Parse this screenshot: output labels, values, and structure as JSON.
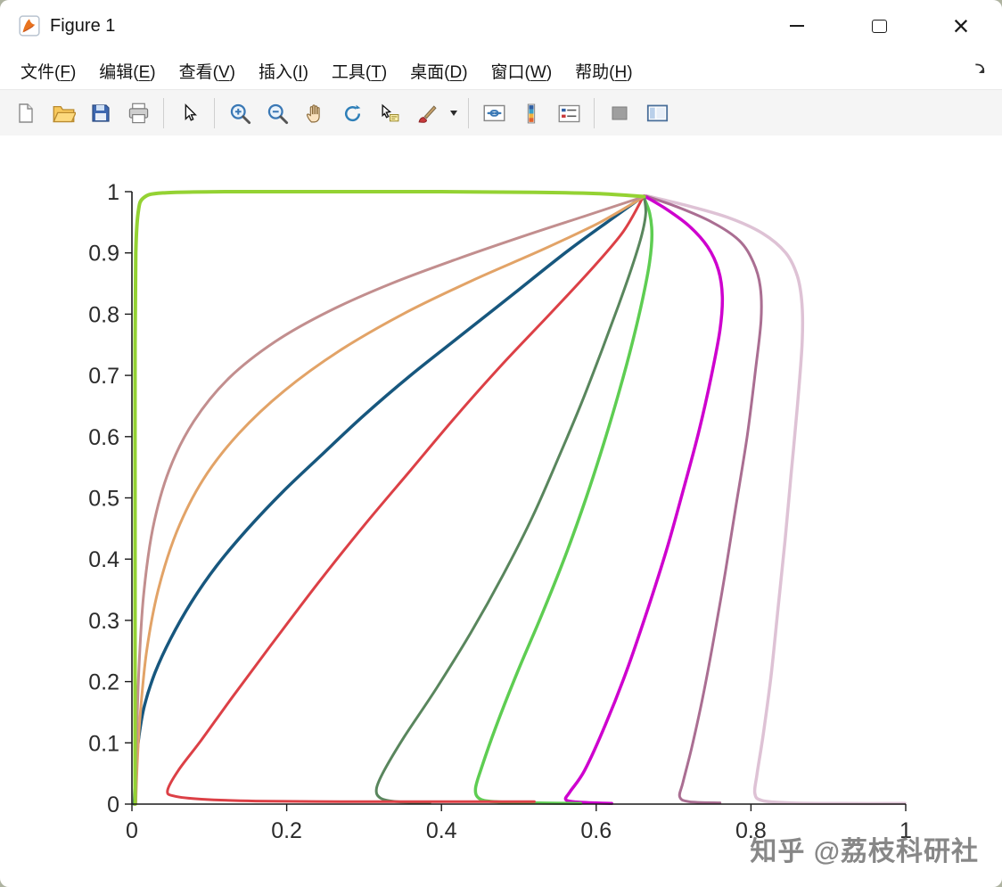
{
  "window": {
    "title": "Figure 1",
    "controls": {
      "minimize_glyph": "–",
      "maximize_glyph": "□",
      "close_glyph": "×"
    }
  },
  "menu": {
    "items": [
      {
        "pre": "文件(",
        "key": "F",
        "post": ")"
      },
      {
        "pre": "编辑(",
        "key": "E",
        "post": ")"
      },
      {
        "pre": "查看(",
        "key": "V",
        "post": ")"
      },
      {
        "pre": "插入(",
        "key": "I",
        "post": ")"
      },
      {
        "pre": "工具(",
        "key": "T",
        "post": ")"
      },
      {
        "pre": "桌面(",
        "key": "D",
        "post": ")"
      },
      {
        "pre": "窗口(",
        "key": "W",
        "post": ")"
      },
      {
        "pre": "帮助(",
        "key": "H",
        "post": ")"
      }
    ]
  },
  "toolbar": {
    "buttons": [
      "new-figure",
      "open-file",
      "save-figure",
      "print-figure",
      "pointer-tool",
      "zoom-in",
      "zoom-out",
      "pan-hand",
      "rotate-3d",
      "data-cursor",
      "brush",
      "brush-dropdown",
      "link-plots",
      "insert-colorbar",
      "insert-legend",
      "hide-plot-tools",
      "show-plot-tools"
    ]
  },
  "watermark": "知乎 @荔枝科研社",
  "chart_data": {
    "type": "line",
    "title": "",
    "xlabel": "",
    "ylabel": "",
    "xlim": [
      0,
      1
    ],
    "ylim": [
      0,
      1
    ],
    "grid": false,
    "legend": "none",
    "xticks": [
      "0",
      "0.2",
      "0.4",
      "0.6",
      "0.8",
      "1"
    ],
    "yticks": [
      "0",
      "0.1",
      "0.2",
      "0.3",
      "0.4",
      "0.5",
      "0.6",
      "0.7",
      "0.8",
      "0.9",
      "1"
    ],
    "series": [
      {
        "name": "pale-pink",
        "color": "#DEC2D5",
        "width": 3.5,
        "points": [
          [
            0.666,
            0.993
          ],
          [
            0.715,
            0.978
          ],
          [
            0.77,
            0.958
          ],
          [
            0.815,
            0.932
          ],
          [
            0.845,
            0.9
          ],
          [
            0.86,
            0.862
          ],
          [
            0.866,
            0.815
          ],
          [
            0.866,
            0.75
          ],
          [
            0.86,
            0.65
          ],
          [
            0.852,
            0.54
          ],
          [
            0.844,
            0.43
          ],
          [
            0.835,
            0.32
          ],
          [
            0.826,
            0.21
          ],
          [
            0.816,
            0.115
          ],
          [
            0.808,
            0.05
          ],
          [
            0.805,
            0.018
          ],
          [
            0.814,
            0.006
          ],
          [
            0.85,
            0.002
          ],
          [
            0.92,
            0.001
          ],
          [
            0.999,
            0.001
          ]
        ]
      },
      {
        "name": "mauve",
        "color": "#AA6E92",
        "width": 3,
        "points": [
          [
            0.664,
            0.993
          ],
          [
            0.705,
            0.975
          ],
          [
            0.75,
            0.95
          ],
          [
            0.785,
            0.92
          ],
          [
            0.803,
            0.885
          ],
          [
            0.812,
            0.845
          ],
          [
            0.813,
            0.79
          ],
          [
            0.806,
            0.71
          ],
          [
            0.795,
            0.6
          ],
          [
            0.781,
            0.49
          ],
          [
            0.767,
            0.38
          ],
          [
            0.752,
            0.27
          ],
          [
            0.737,
            0.17
          ],
          [
            0.723,
            0.09
          ],
          [
            0.712,
            0.035
          ],
          [
            0.708,
            0.012
          ],
          [
            0.72,
            0.004
          ],
          [
            0.76,
            0.002
          ]
        ]
      },
      {
        "name": "magenta",
        "color": "#CE00CE",
        "width": 3.5,
        "points": [
          [
            0.662,
            0.993
          ],
          [
            0.69,
            0.972
          ],
          [
            0.72,
            0.944
          ],
          [
            0.744,
            0.91
          ],
          [
            0.758,
            0.872
          ],
          [
            0.763,
            0.828
          ],
          [
            0.76,
            0.775
          ],
          [
            0.749,
            0.7
          ],
          [
            0.733,
            0.61
          ],
          [
            0.714,
            0.52
          ],
          [
            0.692,
            0.42
          ],
          [
            0.667,
            0.32
          ],
          [
            0.64,
            0.22
          ],
          [
            0.612,
            0.13
          ],
          [
            0.585,
            0.055
          ],
          [
            0.566,
            0.02
          ],
          [
            0.561,
            0.007
          ],
          [
            0.578,
            0.003
          ],
          [
            0.62,
            0.001
          ]
        ]
      },
      {
        "name": "lime-green",
        "color": "#5ECD52",
        "width": 3.5,
        "points": [
          [
            0.661,
            0.992
          ],
          [
            0.669,
            0.965
          ],
          [
            0.672,
            0.93
          ],
          [
            0.669,
            0.885
          ],
          [
            0.66,
            0.825
          ],
          [
            0.647,
            0.755
          ],
          [
            0.63,
            0.675
          ],
          [
            0.61,
            0.59
          ],
          [
            0.587,
            0.5
          ],
          [
            0.56,
            0.405
          ],
          [
            0.53,
            0.31
          ],
          [
            0.498,
            0.215
          ],
          [
            0.47,
            0.125
          ],
          [
            0.452,
            0.06
          ],
          [
            0.444,
            0.025
          ],
          [
            0.449,
            0.009
          ],
          [
            0.468,
            0.004
          ],
          [
            0.52,
            0.002
          ],
          [
            0.58,
            0.001
          ]
        ]
      },
      {
        "name": "dark-green",
        "color": "#59865D",
        "width": 3,
        "points": [
          [
            0.662,
            0.992
          ],
          [
            0.664,
            0.965
          ],
          [
            0.659,
            0.93
          ],
          [
            0.647,
            0.88
          ],
          [
            0.629,
            0.815
          ],
          [
            0.607,
            0.74
          ],
          [
            0.581,
            0.655
          ],
          [
            0.551,
            0.565
          ],
          [
            0.518,
            0.47
          ],
          [
            0.48,
            0.375
          ],
          [
            0.438,
            0.28
          ],
          [
            0.394,
            0.19
          ],
          [
            0.352,
            0.11
          ],
          [
            0.326,
            0.055
          ],
          [
            0.316,
            0.025
          ],
          [
            0.321,
            0.01
          ],
          [
            0.342,
            0.004
          ],
          [
            0.385,
            0.002
          ]
        ]
      },
      {
        "name": "red",
        "color": "#DC4046",
        "width": 3,
        "points": [
          [
            0.52,
            0.004
          ],
          [
            0.4,
            0.004
          ],
          [
            0.28,
            0.004
          ],
          [
            0.16,
            0.005
          ],
          [
            0.09,
            0.008
          ],
          [
            0.055,
            0.013
          ],
          [
            0.046,
            0.022
          ],
          [
            0.06,
            0.055
          ],
          [
            0.09,
            0.105
          ],
          [
            0.13,
            0.175
          ],
          [
            0.18,
            0.26
          ],
          [
            0.24,
            0.36
          ],
          [
            0.3,
            0.455
          ],
          [
            0.36,
            0.545
          ],
          [
            0.42,
            0.635
          ],
          [
            0.48,
            0.72
          ],
          [
            0.54,
            0.8
          ],
          [
            0.595,
            0.875
          ],
          [
            0.635,
            0.935
          ],
          [
            0.66,
            0.99
          ]
        ]
      },
      {
        "name": "steel-blue",
        "color": "#17577E",
        "width": 3.5,
        "points": [
          [
            0.003,
            0.0
          ],
          [
            0.005,
            0.06
          ],
          [
            0.009,
            0.11
          ],
          [
            0.016,
            0.16
          ],
          [
            0.03,
            0.215
          ],
          [
            0.05,
            0.27
          ],
          [
            0.077,
            0.33
          ],
          [
            0.11,
            0.39
          ],
          [
            0.15,
            0.45
          ],
          [
            0.195,
            0.51
          ],
          [
            0.245,
            0.57
          ],
          [
            0.3,
            0.635
          ],
          [
            0.36,
            0.7
          ],
          [
            0.425,
            0.765
          ],
          [
            0.495,
            0.835
          ],
          [
            0.565,
            0.905
          ],
          [
            0.625,
            0.96
          ],
          [
            0.658,
            0.99
          ]
        ]
      },
      {
        "name": "sandy-orange",
        "color": "#E2A367",
        "width": 3,
        "points": [
          [
            0.005,
            0.0
          ],
          [
            0.007,
            0.07
          ],
          [
            0.011,
            0.15
          ],
          [
            0.019,
            0.25
          ],
          [
            0.034,
            0.35
          ],
          [
            0.058,
            0.445
          ],
          [
            0.092,
            0.53
          ],
          [
            0.138,
            0.605
          ],
          [
            0.197,
            0.675
          ],
          [
            0.268,
            0.74
          ],
          [
            0.35,
            0.8
          ],
          [
            0.44,
            0.855
          ],
          [
            0.53,
            0.905
          ],
          [
            0.605,
            0.95
          ],
          [
            0.662,
            0.992
          ]
        ]
      },
      {
        "name": "rosy-brown",
        "color": "#C28E8E",
        "width": 3,
        "points": [
          [
            0.005,
            0.0
          ],
          [
            0.006,
            0.1
          ],
          [
            0.009,
            0.22
          ],
          [
            0.015,
            0.34
          ],
          [
            0.027,
            0.45
          ],
          [
            0.048,
            0.545
          ],
          [
            0.08,
            0.625
          ],
          [
            0.125,
            0.695
          ],
          [
            0.185,
            0.755
          ],
          [
            0.255,
            0.805
          ],
          [
            0.335,
            0.85
          ],
          [
            0.42,
            0.89
          ],
          [
            0.505,
            0.927
          ],
          [
            0.585,
            0.96
          ],
          [
            0.662,
            0.992
          ]
        ]
      },
      {
        "name": "yellow-green",
        "color": "#94D233",
        "width": 4,
        "points": [
          [
            0.004,
            0.0
          ],
          [
            0.004,
            0.25
          ],
          [
            0.004,
            0.5
          ],
          [
            0.004,
            0.75
          ],
          [
            0.005,
            0.9
          ],
          [
            0.008,
            0.965
          ],
          [
            0.015,
            0.99
          ],
          [
            0.04,
            0.998
          ],
          [
            0.12,
            1.0
          ],
          [
            0.25,
            1.0
          ],
          [
            0.4,
            1.0
          ],
          [
            0.52,
            0.999
          ],
          [
            0.6,
            0.997
          ],
          [
            0.662,
            0.992
          ]
        ]
      }
    ]
  }
}
